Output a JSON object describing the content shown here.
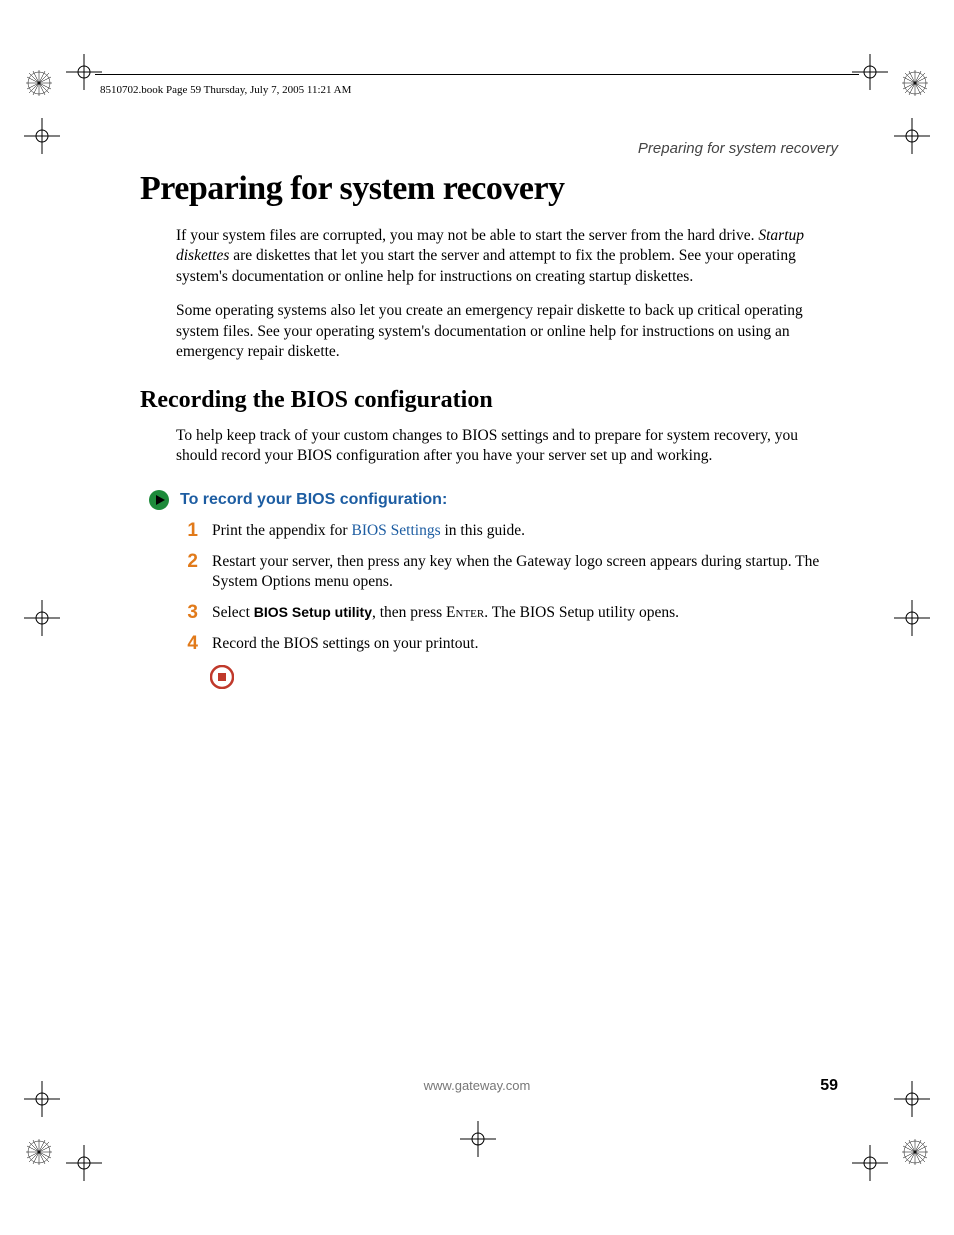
{
  "header": {
    "book_info": "8510702.book  Page 59  Thursday, July 7, 2005  11:21 AM"
  },
  "running_head": "Preparing for system recovery",
  "title": "Preparing for system recovery",
  "para1_pre": "If your system files are corrupted, you may not be able to start the server from the hard drive. ",
  "para1_em": "Startup diskettes",
  "para1_post": " are diskettes that let you start the server and attempt to fix the problem. See your operating system's documentation or online help for instructions on creating startup diskettes.",
  "para2": "Some operating systems also let you create an emergency repair diskette to back up critical operating system files. See your operating system's documentation or online help for instructions on using an emergency repair diskette.",
  "subtitle": "Recording the BIOS configuration",
  "para3": "To help keep track of your custom changes to BIOS settings and to prepare for system recovery, you should record your BIOS configuration after you have your server set up and working.",
  "proc_head": "To record your BIOS configuration:",
  "steps": {
    "n1": "1",
    "s1_pre": "Print the appendix for ",
    "s1_link": "BIOS Settings",
    "s1_post": " in this guide.",
    "n2": "2",
    "s2": "Restart your server, then press any key when the Gateway logo screen appears during startup. The System Options menu opens.",
    "n3": "3",
    "s3_pre": "Select ",
    "s3_ui": "BIOS Setup utility",
    "s3_mid": ", then press ",
    "s3_key": "Enter",
    "s3_post": ". The BIOS Setup utility opens.",
    "n4": "4",
    "s4": "Record the BIOS settings on your printout."
  },
  "footer_url": "www.gateway.com",
  "page_number": "59"
}
